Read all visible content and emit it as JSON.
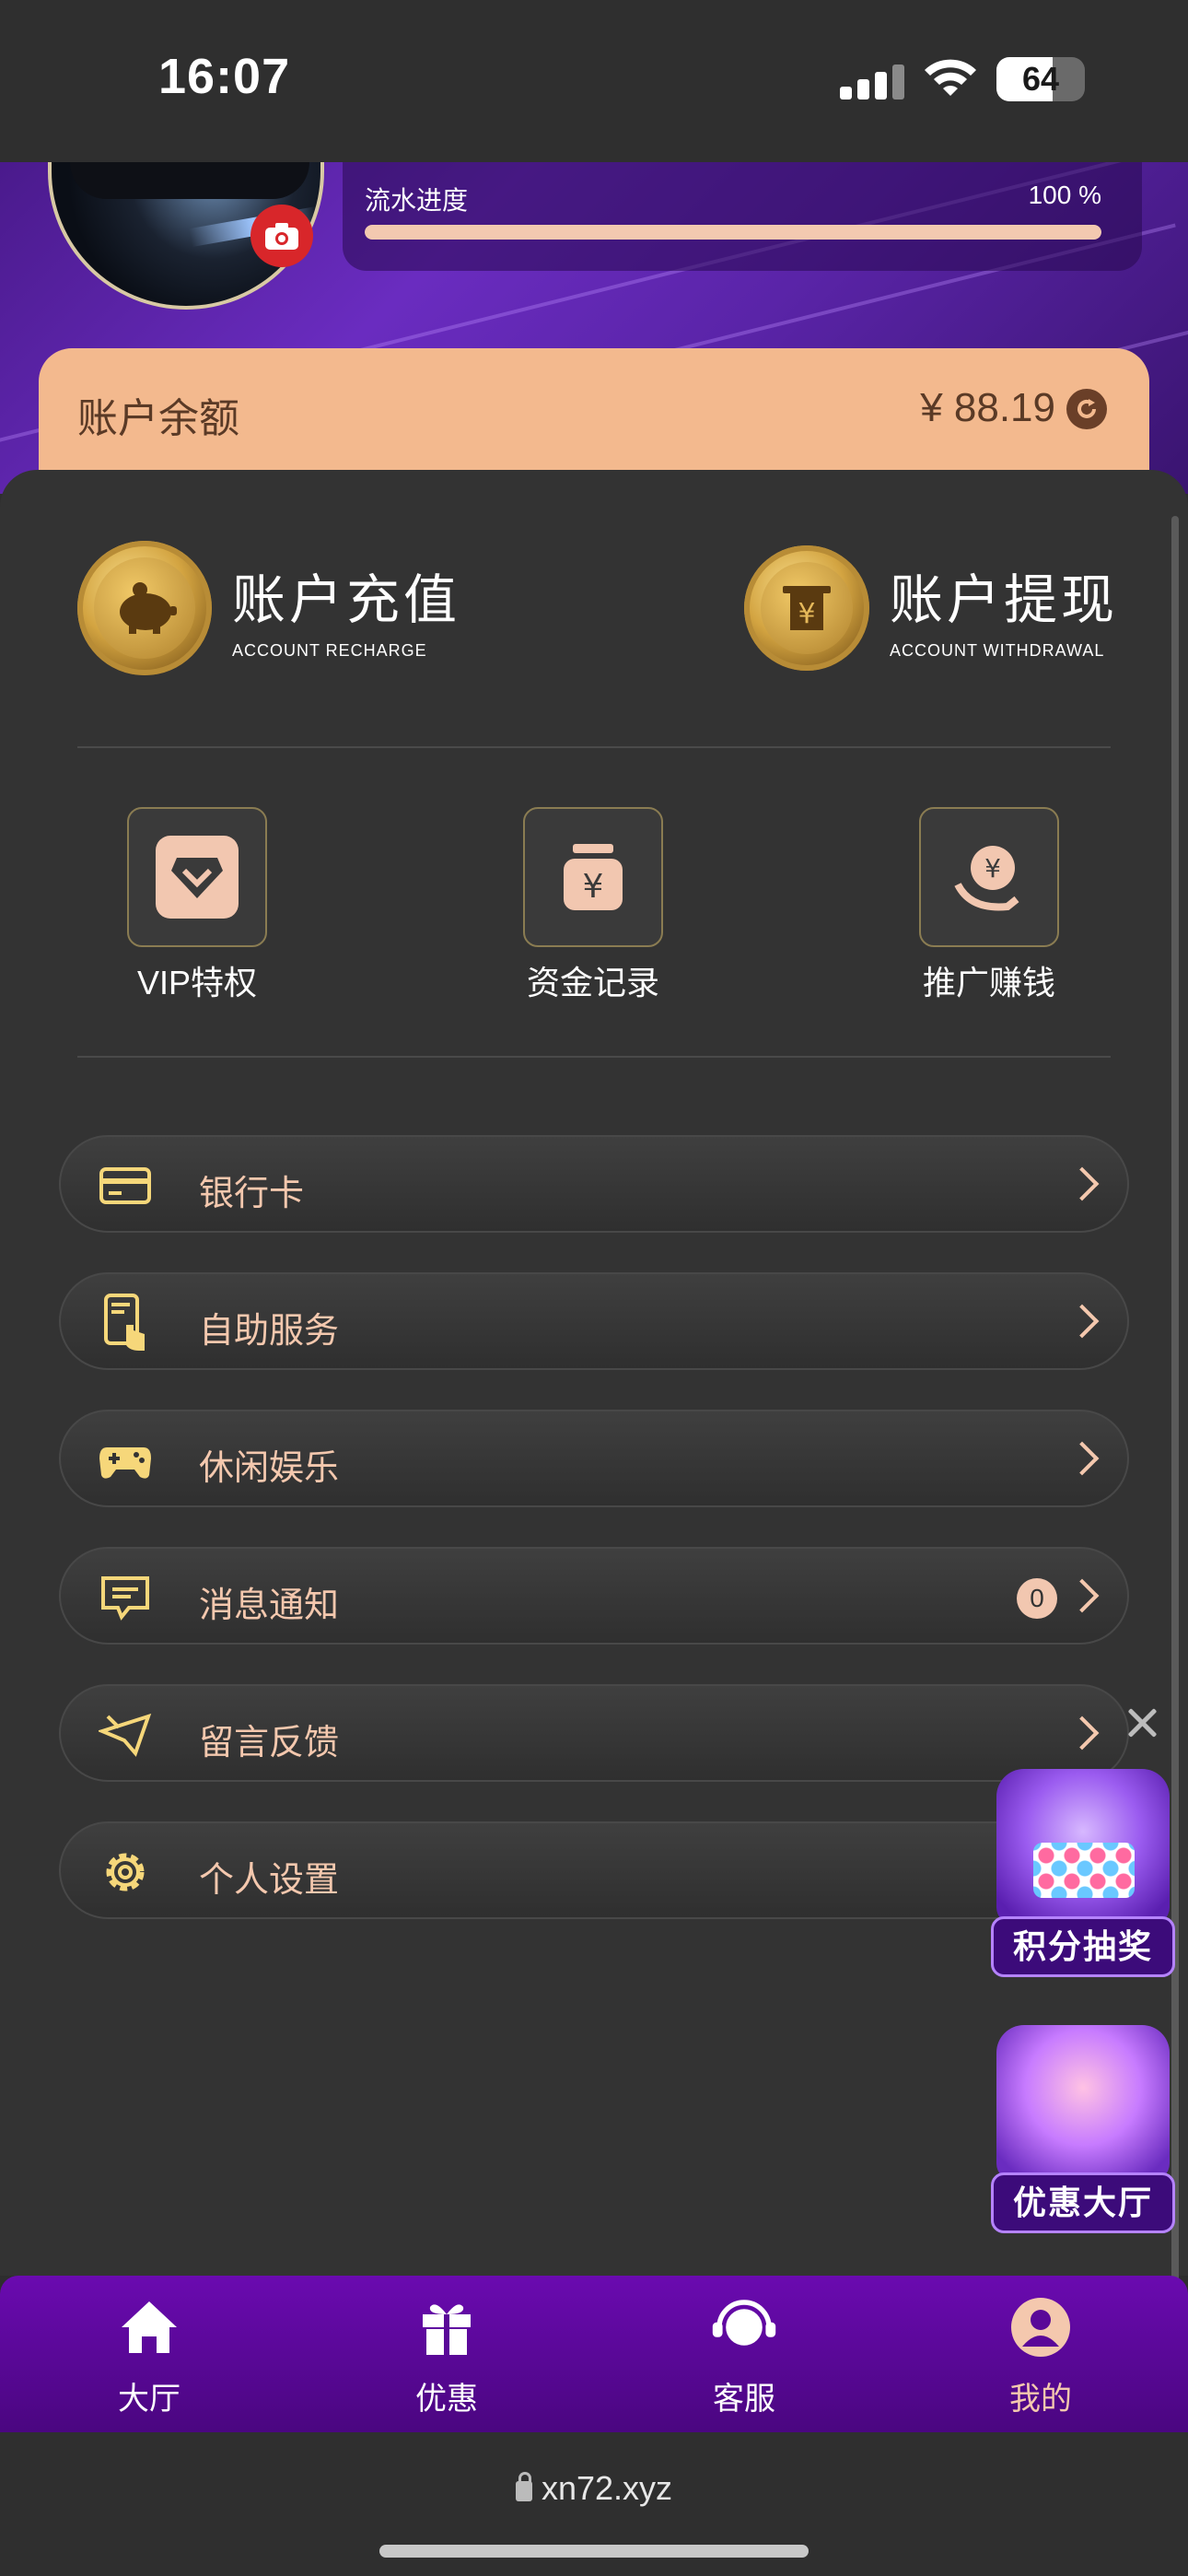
{
  "status_bar": {
    "time": "16:07",
    "battery": "64",
    "battery_level": 0.64
  },
  "header": {
    "progress_label": "流水进度",
    "progress_value": "100 %",
    "progress_fraction": 1.0
  },
  "balance": {
    "label": "账户余额",
    "value": "¥ 88.19"
  },
  "actions": [
    {
      "title": "账户充值",
      "subtitle": "ACCOUNT RECHARGE"
    },
    {
      "title": "账户提现",
      "subtitle": "ACCOUNT WITHDRAWAL"
    }
  ],
  "quick_links": [
    {
      "label": "VIP特权"
    },
    {
      "label": "资金记录"
    },
    {
      "label": "推广赚钱"
    }
  ],
  "menu": [
    {
      "label": "银行卡"
    },
    {
      "label": "自助服务"
    },
    {
      "label": "休闲娱乐"
    },
    {
      "label": "消息通知",
      "badge": "0"
    },
    {
      "label": "留言反馈"
    },
    {
      "label": "个人设置"
    }
  ],
  "floating": {
    "lottery": "积分抽奖",
    "promo_hall": "优惠大厅"
  },
  "tabbar": [
    {
      "label": "大厅"
    },
    {
      "label": "优惠"
    },
    {
      "label": "客服"
    },
    {
      "label": "我的"
    }
  ],
  "browser": {
    "url": "xn72.xyz"
  },
  "colors": {
    "accent": "#f4c8ae",
    "brand_purple": "#6a0ab0",
    "balance_bg": "#f3b98e"
  }
}
